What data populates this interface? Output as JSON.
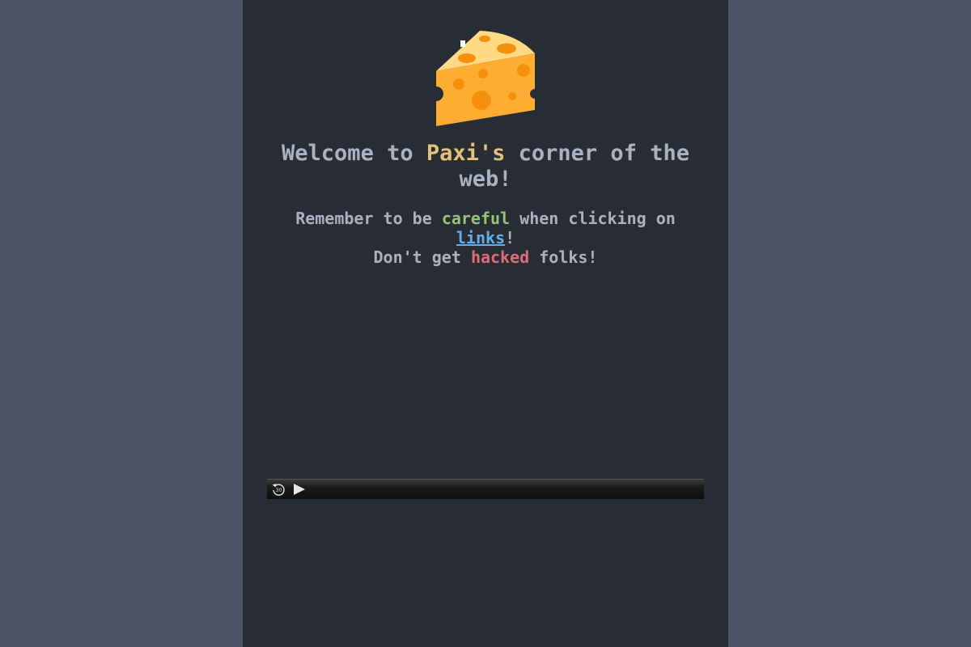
{
  "logo": {
    "icon": "cheese-icon"
  },
  "heading": {
    "part1": "Welcome to ",
    "name": "Paxi's",
    "part2": " corner of the web!"
  },
  "notice": {
    "line1_start": "Remember to be ",
    "careful": "careful",
    "line1_mid": " when clicking on ",
    "links": "links",
    "line1_end": "!",
    "line2_start": "Don't get ",
    "hacked": "hacked",
    "line2_end": " folks!"
  },
  "player": {
    "skip_icon": "skip-back-30-icon",
    "skip_label": "30",
    "play_icon": "play-icon"
  },
  "colors": {
    "outer_background": "#4c5265",
    "page_background": "#282c35",
    "text": "#abb2bf",
    "accent_yellow": "#e5c07b",
    "accent_green": "#98c379",
    "accent_blue": "#61afef",
    "accent_red": "#e06c75"
  }
}
